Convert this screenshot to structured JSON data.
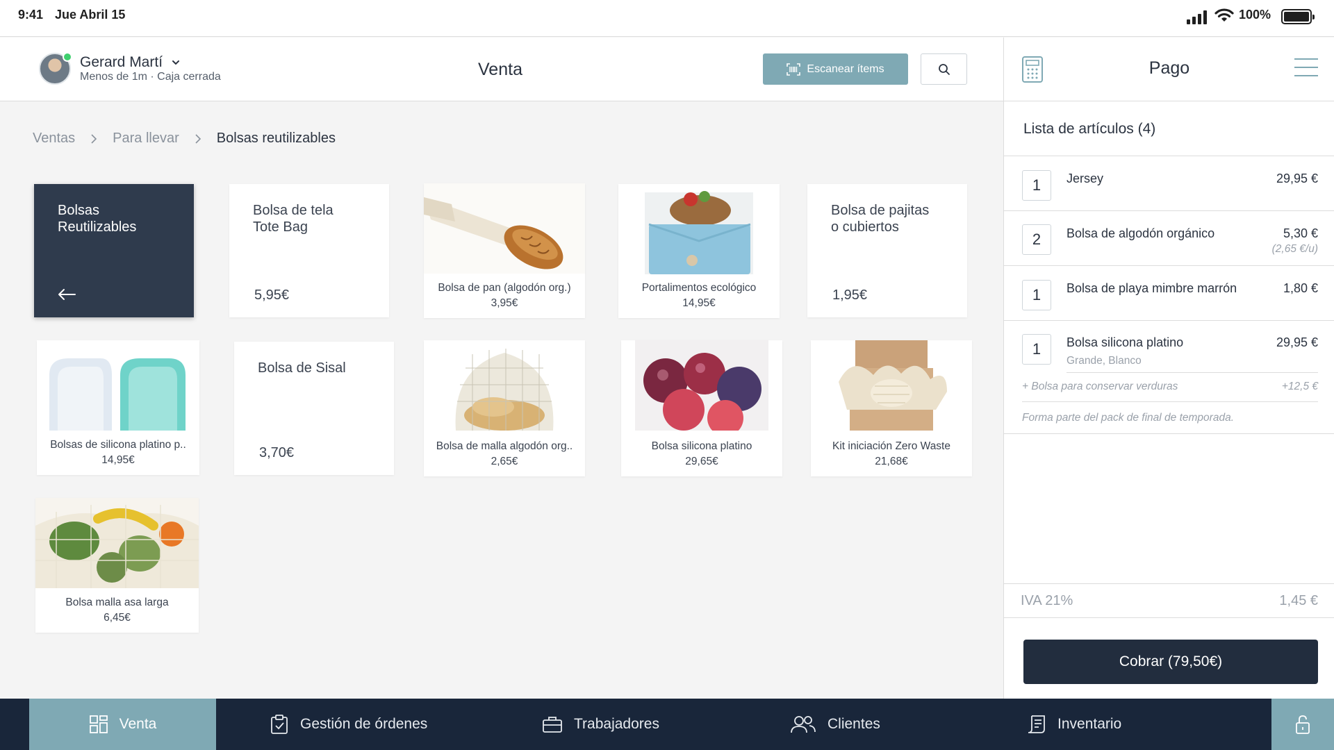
{
  "status_bar": {
    "time": "9:41",
    "date": "Jue Abril 15",
    "battery": "100%"
  },
  "header": {
    "user_name": "Gerard Martí",
    "user_status": "Menos de 1m · Caja cerrada",
    "title": "Venta",
    "scan_label": "Escanear ítems"
  },
  "breadcrumb": [
    "Ventas",
    "Para llevar",
    "Bolsas reutilizables"
  ],
  "category_tile": {
    "label": "Bolsas\nReutilizables"
  },
  "products": [
    {
      "name": "Bolsa de tela\nTote Bag",
      "price": "5,95€"
    },
    {
      "name": "Bolsa de pan (algodón org.)",
      "price": "3,95€",
      "image": "bread-bag-image"
    },
    {
      "name": "Portalimentos ecológico",
      "price": "14,95€",
      "image": "food-wrap-image"
    },
    {
      "name": "Bolsa de pajitas\no cubiertos",
      "price": "1,95€"
    },
    {
      "name": "Bolsas de silicona platino p..",
      "price": "14,95€",
      "image": "silicone-bags-image"
    },
    {
      "name": "Bolsa de Sisal",
      "price": "3,70€"
    },
    {
      "name": "Bolsa de malla algodón org..",
      "price": "2,65€",
      "image": "mesh-bag-image"
    },
    {
      "name": "Bolsa silicona platino",
      "price": "29,65€",
      "image": "tomato-bag-image"
    },
    {
      "name": "Kit iniciación Zero Waste",
      "price": "21,68€",
      "image": "zero-waste-kit-image"
    },
    {
      "name": "Bolsa malla asa larga",
      "price": "6,45€",
      "image": "fruit-net-image"
    }
  ],
  "panel": {
    "title": "Pago",
    "list_title": "Lista de artículos (4)",
    "items": [
      {
        "qty": "1",
        "name": "Jersey",
        "price": "29,95 €"
      },
      {
        "qty": "2",
        "name": "Bolsa de algodón orgánico",
        "price": "5,30 €",
        "unit_price": "(2,65 €/u)"
      },
      {
        "qty": "1",
        "name": "Bolsa de playa mimbre marrón",
        "price": "1,80 €"
      },
      {
        "qty": "1",
        "name": "Bolsa silicona platino",
        "price": "29,95 €",
        "variant": "Grande, Blanco"
      }
    ],
    "addon": {
      "label": "+ Bolsa para conservar verduras",
      "price": "+12,5 €"
    },
    "note": "Forma parte del pack de final de temporada.",
    "tax_label": "IVA 21%",
    "tax_value": "1,45 €",
    "charge_label": "Cobrar (79,50€)"
  },
  "nav": [
    {
      "label": "Venta",
      "icon": "grid-icon"
    },
    {
      "label": "Gestión de órdenes",
      "icon": "clipboard-check-icon"
    },
    {
      "label": "Trabajadores",
      "icon": "briefcase-icon"
    },
    {
      "label": "Clientes",
      "icon": "users-icon"
    },
    {
      "label": "Inventario",
      "icon": "inventory-icon"
    }
  ],
  "colors": {
    "accent": "#7fa9b4",
    "dark": "#2f3b4d",
    "nav_bg": "#19263a",
    "charge": "#222d3e"
  }
}
